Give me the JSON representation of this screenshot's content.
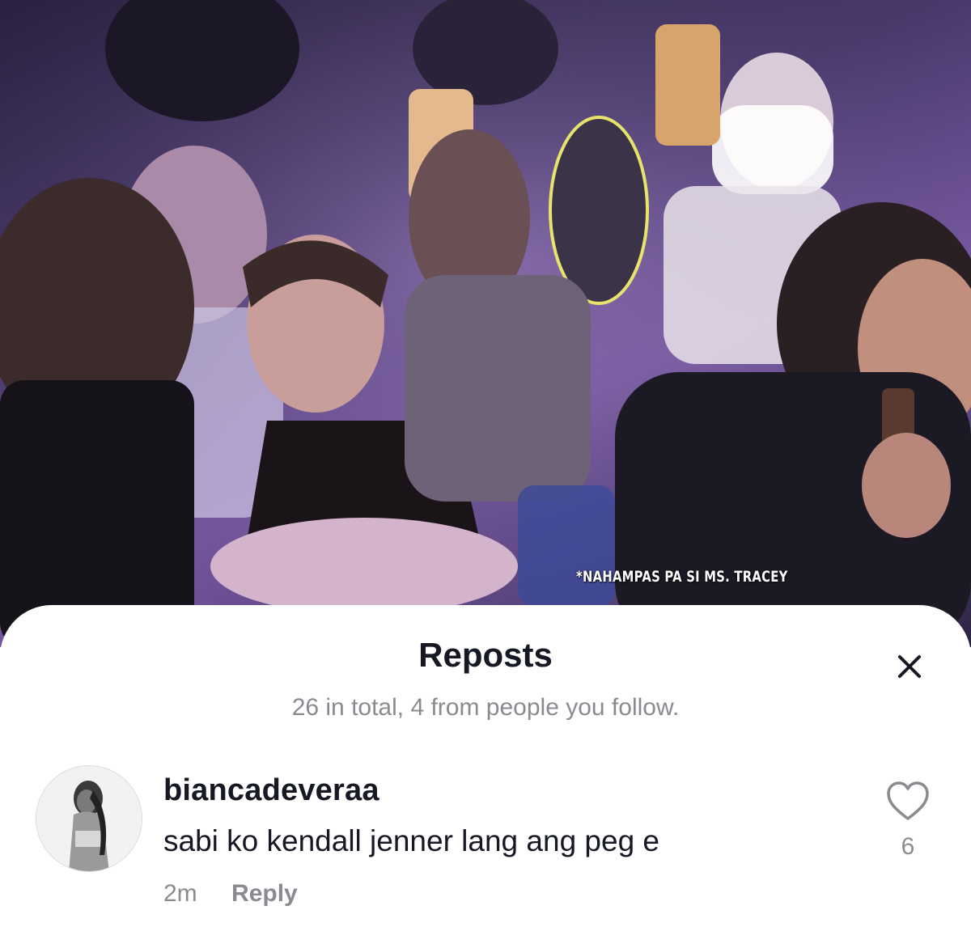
{
  "video": {
    "caption": "*NAHAMPAS PA SI MS. TRACEY"
  },
  "sheet": {
    "title": "Reposts",
    "subtitle": "26 in total, 4 from people you follow.",
    "close_icon": "close-icon"
  },
  "comment": {
    "username": "biancadeveraa",
    "text": "sabi ko kendall jenner lang ang peg e",
    "time": "2m",
    "reply_label": "Reply",
    "like_icon": "heart-outline-icon",
    "like_count": "6"
  },
  "colors": {
    "primary_text": "#161823",
    "secondary_text": "#8a8b91",
    "sheet_background": "#ffffff"
  }
}
